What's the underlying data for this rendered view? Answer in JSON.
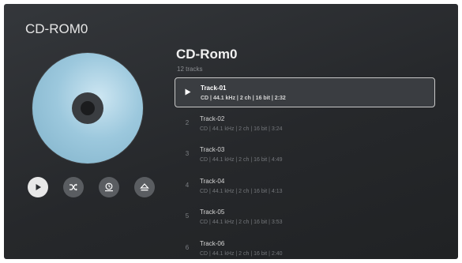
{
  "app": {
    "title": "CD-ROM0"
  },
  "album": {
    "title": "CD-Rom0",
    "subtitle": "12 tracks"
  },
  "controls": [
    {
      "name": "play-button",
      "icon": "play-icon"
    },
    {
      "name": "shuffle-button",
      "icon": "shuffle-icon"
    },
    {
      "name": "repeat-button",
      "icon": "repeat-icon"
    },
    {
      "name": "eject-button",
      "icon": "eject-icon"
    }
  ],
  "tracks": [
    {
      "number": "1",
      "title": "Track-01",
      "meta": "CD | 44.1 kHz | 2 ch | 16 bit | 2:32",
      "selected": true
    },
    {
      "number": "2",
      "title": "Track-02",
      "meta": "CD | 44.1 kHz | 2 ch | 16 bit | 3:24"
    },
    {
      "number": "3",
      "title": "Track-03",
      "meta": "CD | 44.1 kHz | 2 ch | 16 bit | 4:49"
    },
    {
      "number": "4",
      "title": "Track-04",
      "meta": "CD | 44.1 kHz | 2 ch | 16 bit | 4:13"
    },
    {
      "number": "5",
      "title": "Track-05",
      "meta": "CD | 44.1 kHz | 2 ch | 16 bit | 3:53"
    },
    {
      "number": "6",
      "title": "Track-06",
      "meta": "CD | 44.1 kHz | 2 ch | 16 bit | 2:40"
    }
  ],
  "colors": {
    "background": "#2b2d30",
    "selection_border": "#c8c8c8",
    "disc": "#9cc8dd"
  }
}
